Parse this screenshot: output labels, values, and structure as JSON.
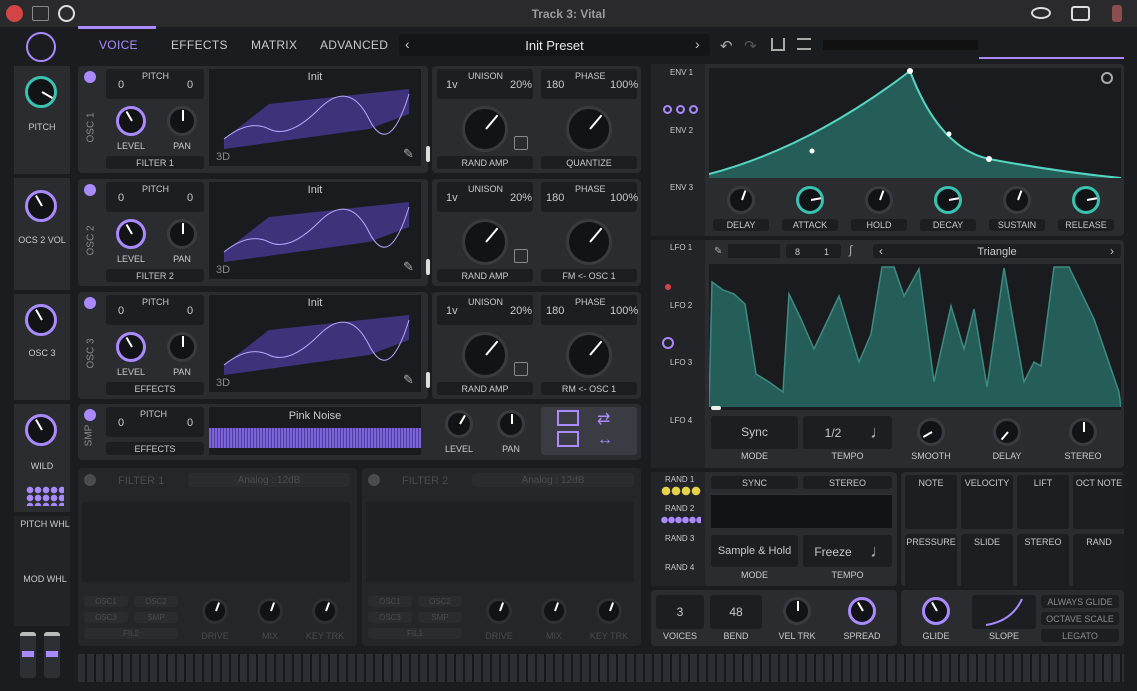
{
  "title": "Track 3: Vital",
  "tabs": [
    "VOICE",
    "EFFECTS",
    "MATRIX",
    "ADVANCED"
  ],
  "preset": "Init Preset",
  "osc": [
    {
      "label": "OSC 1",
      "pitch": "PITCH",
      "pl": "0",
      "pr": "0",
      "wave": "Init",
      "dest": "FILTER 1",
      "unison": "UNISON",
      "uv": "1v",
      "upct": "20%",
      "phase": "PHASE",
      "ph": "180",
      "ppct": "100%",
      "r1": "RAND AMP",
      "r2": "QUANTIZE"
    },
    {
      "label": "OSC 2",
      "pitch": "PITCH",
      "pl": "0",
      "pr": "0",
      "wave": "Init",
      "dest": "FILTER 2",
      "unison": "UNISON",
      "uv": "1v",
      "upct": "20%",
      "phase": "PHASE",
      "ph": "180",
      "ppct": "100%",
      "r1": "RAND AMP",
      "r2": "FM <- OSC 1"
    },
    {
      "label": "OSC 3",
      "pitch": "PITCH",
      "pl": "0",
      "pr": "0",
      "wave": "Init",
      "dest": "EFFECTS",
      "unison": "UNISON",
      "uv": "1v",
      "upct": "20%",
      "phase": "PHASE",
      "ph": "180",
      "ppct": "100%",
      "r1": "RAND AMP",
      "r2": "RM <- OSC 1"
    }
  ],
  "level": "LEVEL",
  "pan": "PAN",
  "d3": "3D",
  "smp": {
    "label": "SMP",
    "pitch": "PITCH",
    "pl": "0",
    "pr": "0",
    "wave": "Pink Noise",
    "dest": "EFFECTS",
    "level": "LEVEL",
    "pan": "PAN"
  },
  "leftmacros": [
    "PITCH",
    "OCS 2 VOL",
    "OSC 3",
    "WILD"
  ],
  "wheels": [
    "PITCH WHL",
    "MOD WHL"
  ],
  "filters": [
    {
      "name": "FILTER 1",
      "type": "Analog : 12dB",
      "a": "OSC1",
      "b": "OSC2",
      "c": "OSC3",
      "d": "SMP",
      "e": "FIL2",
      "k1": "DRIVE",
      "k2": "MIX",
      "k3": "KEY TRK"
    },
    {
      "name": "FILTER 2",
      "type": "Analog : 12dB",
      "a": "OSC1",
      "b": "OSC2",
      "c": "OSC3",
      "d": "SMP",
      "e": "FIL1",
      "k1": "DRIVE",
      "k2": "MIX",
      "k3": "KEY TRK"
    }
  ],
  "env": [
    "ENV 1",
    "ENV 2",
    "ENV 3"
  ],
  "envknobs": [
    "DELAY",
    "ATTACK",
    "HOLD",
    "DECAY",
    "SUSTAIN",
    "RELEASE"
  ],
  "lfo": [
    "LFO 1",
    "LFO 2",
    "LFO 3",
    "LFO 4"
  ],
  "lfoshape": "Triangle",
  "lfofreq": "8",
  "lfofreq2": "1",
  "lfoctl": {
    "sync": "Sync",
    "mode": "MODE",
    "tempo": "1/2",
    "tlbl": "TEMPO",
    "k": [
      "SMOOTH",
      "DELAY",
      "STEREO"
    ]
  },
  "rand": [
    "RAND 1",
    "RAND 2",
    "RAND 3",
    "RAND 4"
  ],
  "randctl": {
    "sync": "SYNC",
    "stereo": "STEREO",
    "mode": "Sample & Hold",
    "mlbl": "MODE",
    "tempo": "Freeze",
    "tlbl": "TEMPO"
  },
  "mods": [
    "NOTE",
    "VELOCITY",
    "LIFT",
    "OCT NOTE",
    "PRESSURE",
    "SLIDE",
    "STEREO",
    "RAND"
  ],
  "voice": {
    "voices": "3",
    "vl": "VOICES",
    "bend": "48",
    "bl": "BEND",
    "k1": "VEL TRK",
    "k2": "SPREAD"
  },
  "glide": {
    "k1": "GLIDE",
    "k2": "SLOPE",
    "b1": "ALWAYS GLIDE",
    "b2": "OCTAVE SCALE",
    "b3": "LEGATO"
  },
  "colors": {
    "purple": "#a98bff",
    "teal": "#39c2b0"
  }
}
